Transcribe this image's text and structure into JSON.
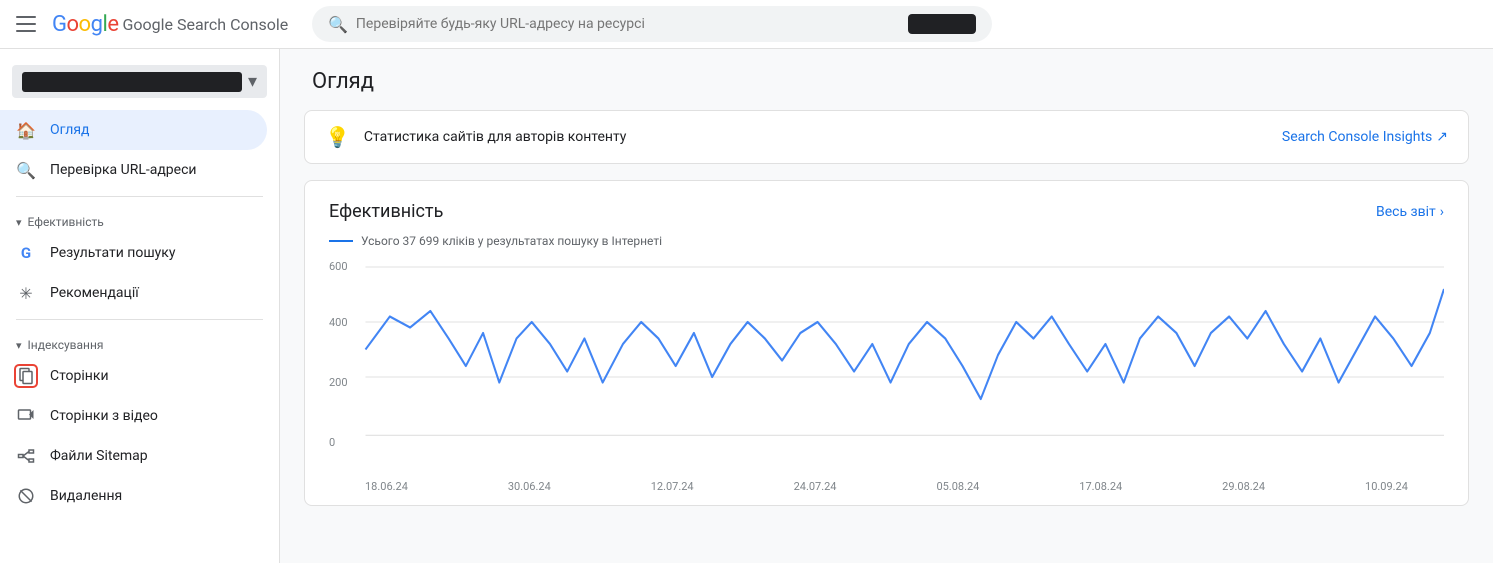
{
  "header": {
    "title": "Google Search Console",
    "search_placeholder": "Перевіряйте будь-яку URL-адресу на ресурсі",
    "search_value": ""
  },
  "sidebar": {
    "property_name": "",
    "nav_items": [
      {
        "id": "overview",
        "label": "Огляд",
        "icon": "home",
        "active": true,
        "section": null
      },
      {
        "id": "url-check",
        "label": "Перевірка URL-адреси",
        "icon": "search",
        "active": false,
        "section": null
      },
      {
        "id": "search-results",
        "label": "Результати пошуку",
        "icon": "G",
        "active": false,
        "section": "Ефективність"
      },
      {
        "id": "recommendations",
        "label": "Рекомендації",
        "icon": "asterisk",
        "active": false,
        "section": null
      },
      {
        "id": "pages",
        "label": "Сторінки",
        "icon": "pages",
        "active": false,
        "highlighted": true,
        "section": "Індексування"
      },
      {
        "id": "video-pages",
        "label": "Сторінки з відео",
        "icon": "video-pages",
        "active": false,
        "section": null
      },
      {
        "id": "sitemap",
        "label": "Файли Sitemap",
        "icon": "sitemap",
        "active": false,
        "section": null
      },
      {
        "id": "removal",
        "label": "Видалення",
        "icon": "removal",
        "active": false,
        "section": null
      }
    ]
  },
  "main": {
    "page_title": "Огляд",
    "insights_banner": {
      "text": "Статистика сайтів для авторів контенту",
      "link_text": "Search Console Insights",
      "link_icon": "external"
    },
    "chart": {
      "title": "Ефективність",
      "link_text": "Весь звіт",
      "legend_text": "Усього 37 699 кліків у результатах пошуку в Інтернеті",
      "y_axis": {
        "max": 600,
        "mid": 400,
        "low": 200,
        "min": 0
      },
      "x_axis": [
        "18.06.24",
        "30.06.24",
        "12.07.24",
        "24.07.24",
        "05.08.24",
        "17.08.24",
        "29.08.24",
        "10.09.24"
      ]
    }
  }
}
